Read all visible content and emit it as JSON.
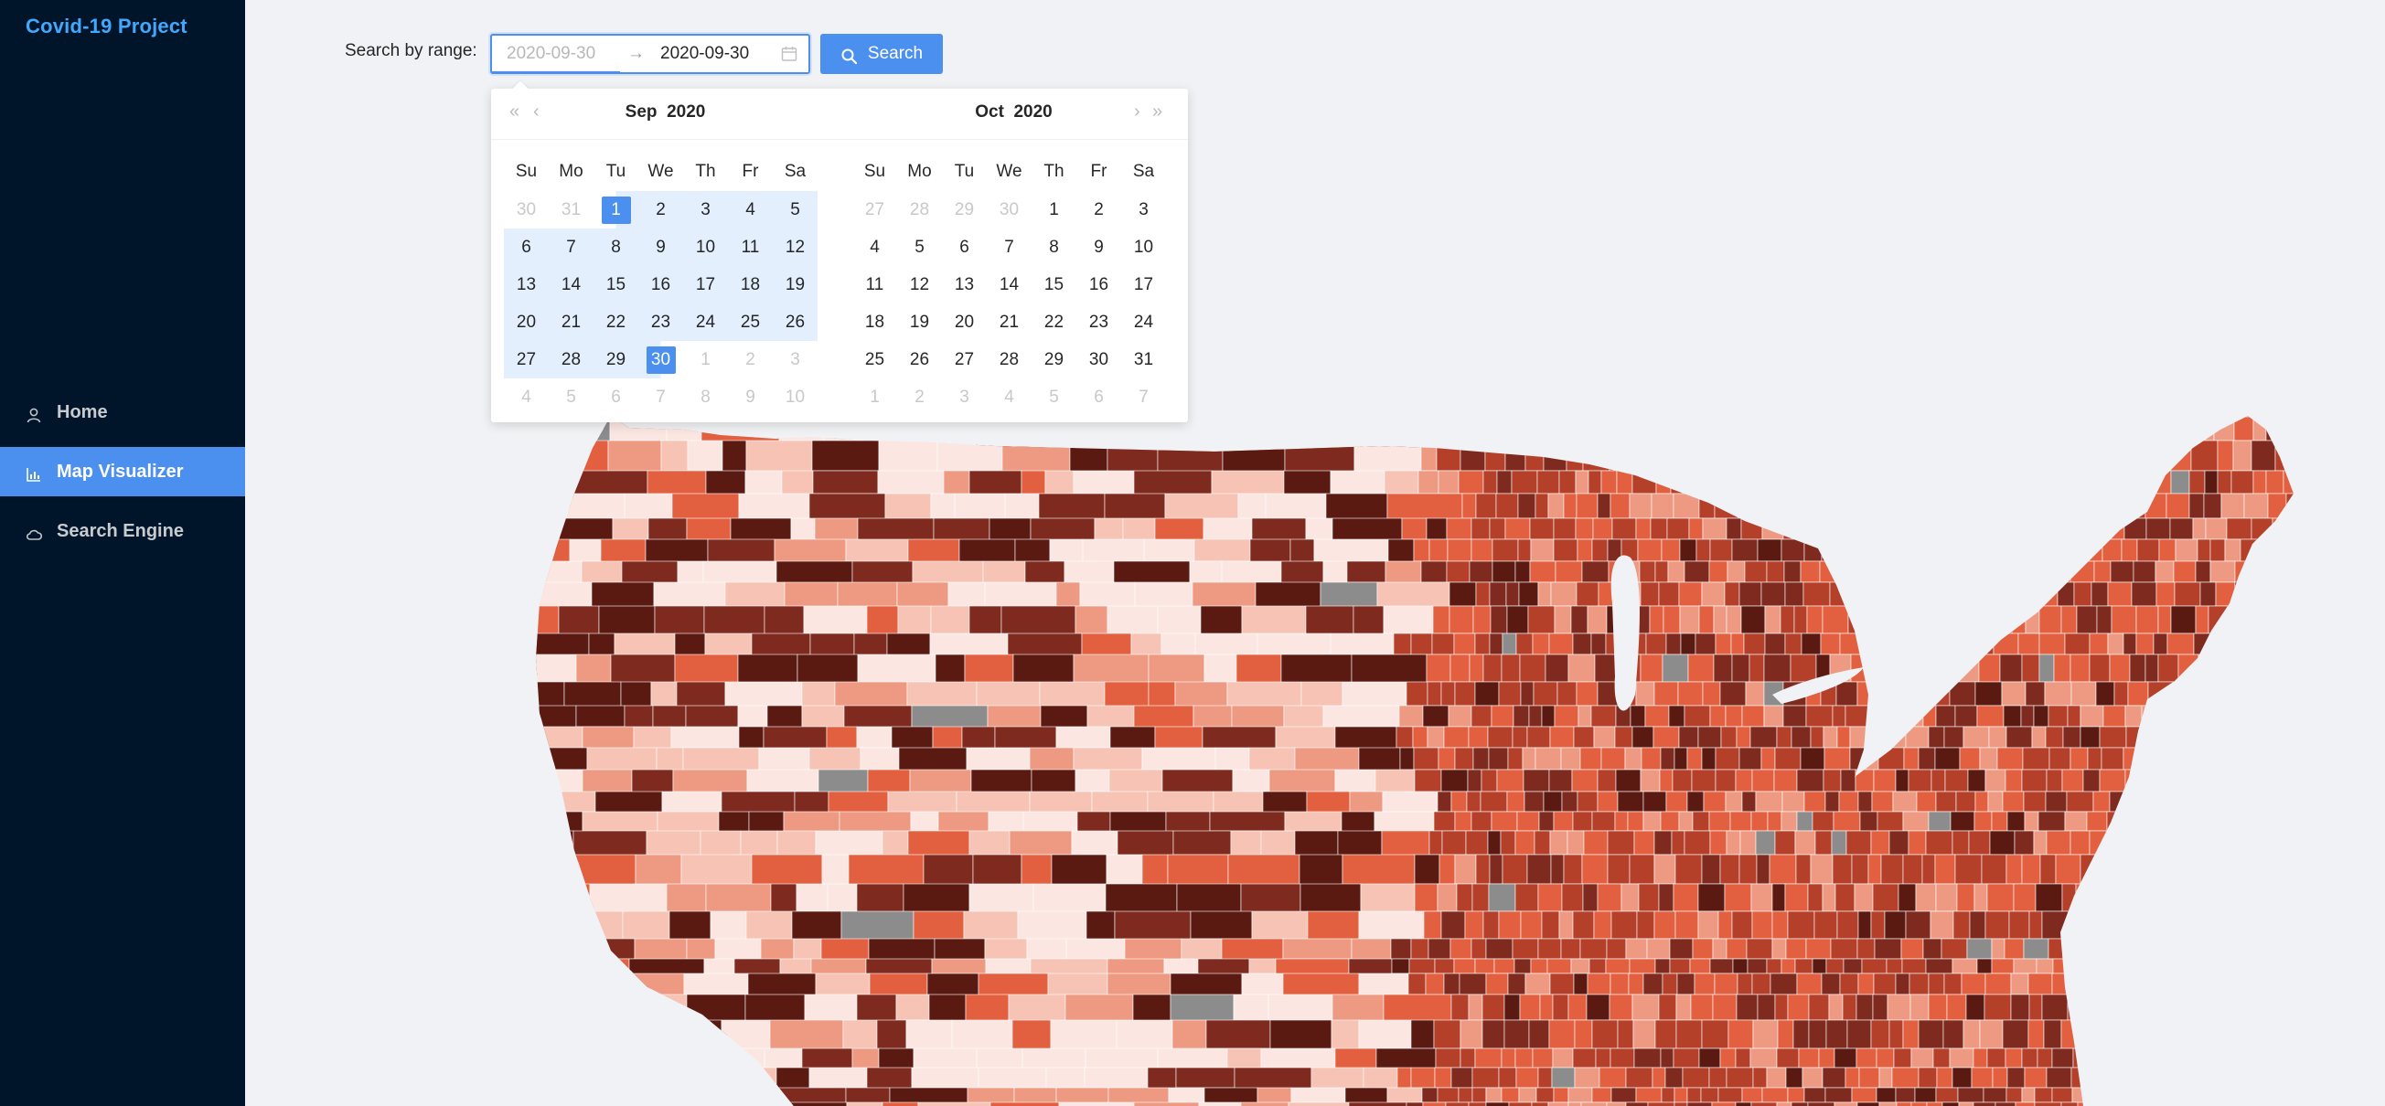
{
  "app": {
    "title": "Covid-19 Project"
  },
  "sidebar": {
    "items": [
      {
        "label": "Home",
        "icon": "user-icon",
        "active": false
      },
      {
        "label": "Map Visualizer",
        "icon": "bar-chart-icon",
        "active": true
      },
      {
        "label": "Search Engine",
        "icon": "cloud-icon",
        "active": false
      }
    ]
  },
  "toolbar": {
    "search_label": "Search by range:",
    "range_start_placeholder": "2020-09-30",
    "range_separator": "→",
    "range_end_value": "2020-09-30",
    "search_button_label": "Search"
  },
  "picker": {
    "left_month": "Sep",
    "left_year": "2020",
    "right_month": "Oct",
    "right_year": "2020",
    "weekdays": [
      "Su",
      "Mo",
      "Tu",
      "We",
      "Th",
      "Fr",
      "Sa"
    ],
    "left_weeks": [
      [
        "30",
        "31",
        "1",
        "2",
        "3",
        "4",
        "5"
      ],
      [
        "6",
        "7",
        "8",
        "9",
        "10",
        "11",
        "12"
      ],
      [
        "13",
        "14",
        "15",
        "16",
        "17",
        "18",
        "19"
      ],
      [
        "20",
        "21",
        "22",
        "23",
        "24",
        "25",
        "26"
      ],
      [
        "27",
        "28",
        "29",
        "30",
        "1",
        "2",
        "3"
      ],
      [
        "4",
        "5",
        "6",
        "7",
        "8",
        "9",
        "10"
      ]
    ],
    "right_weeks": [
      [
        "27",
        "28",
        "29",
        "30",
        "1",
        "2",
        "3"
      ],
      [
        "4",
        "5",
        "6",
        "7",
        "8",
        "9",
        "10"
      ],
      [
        "11",
        "12",
        "13",
        "14",
        "15",
        "16",
        "17"
      ],
      [
        "18",
        "19",
        "20",
        "21",
        "22",
        "23",
        "24"
      ],
      [
        "25",
        "26",
        "27",
        "28",
        "29",
        "30",
        "31"
      ],
      [
        "1",
        "2",
        "3",
        "4",
        "5",
        "6",
        "7"
      ]
    ],
    "selected_start": "Sep 1",
    "selected_end": "Sep 30"
  },
  "colors": {
    "sidebar_bg": "#001529",
    "accent": "#4c90ef",
    "logo": "#40a9ff",
    "range_bg": "#e3effd",
    "map_scale": [
      "#fbe6e1",
      "#f6c3b5",
      "#ee9a83",
      "#e2603f",
      "#b5402a",
      "#7f2a1e",
      "#5a1a12"
    ],
    "map_nodata": "#8c8c8c"
  }
}
